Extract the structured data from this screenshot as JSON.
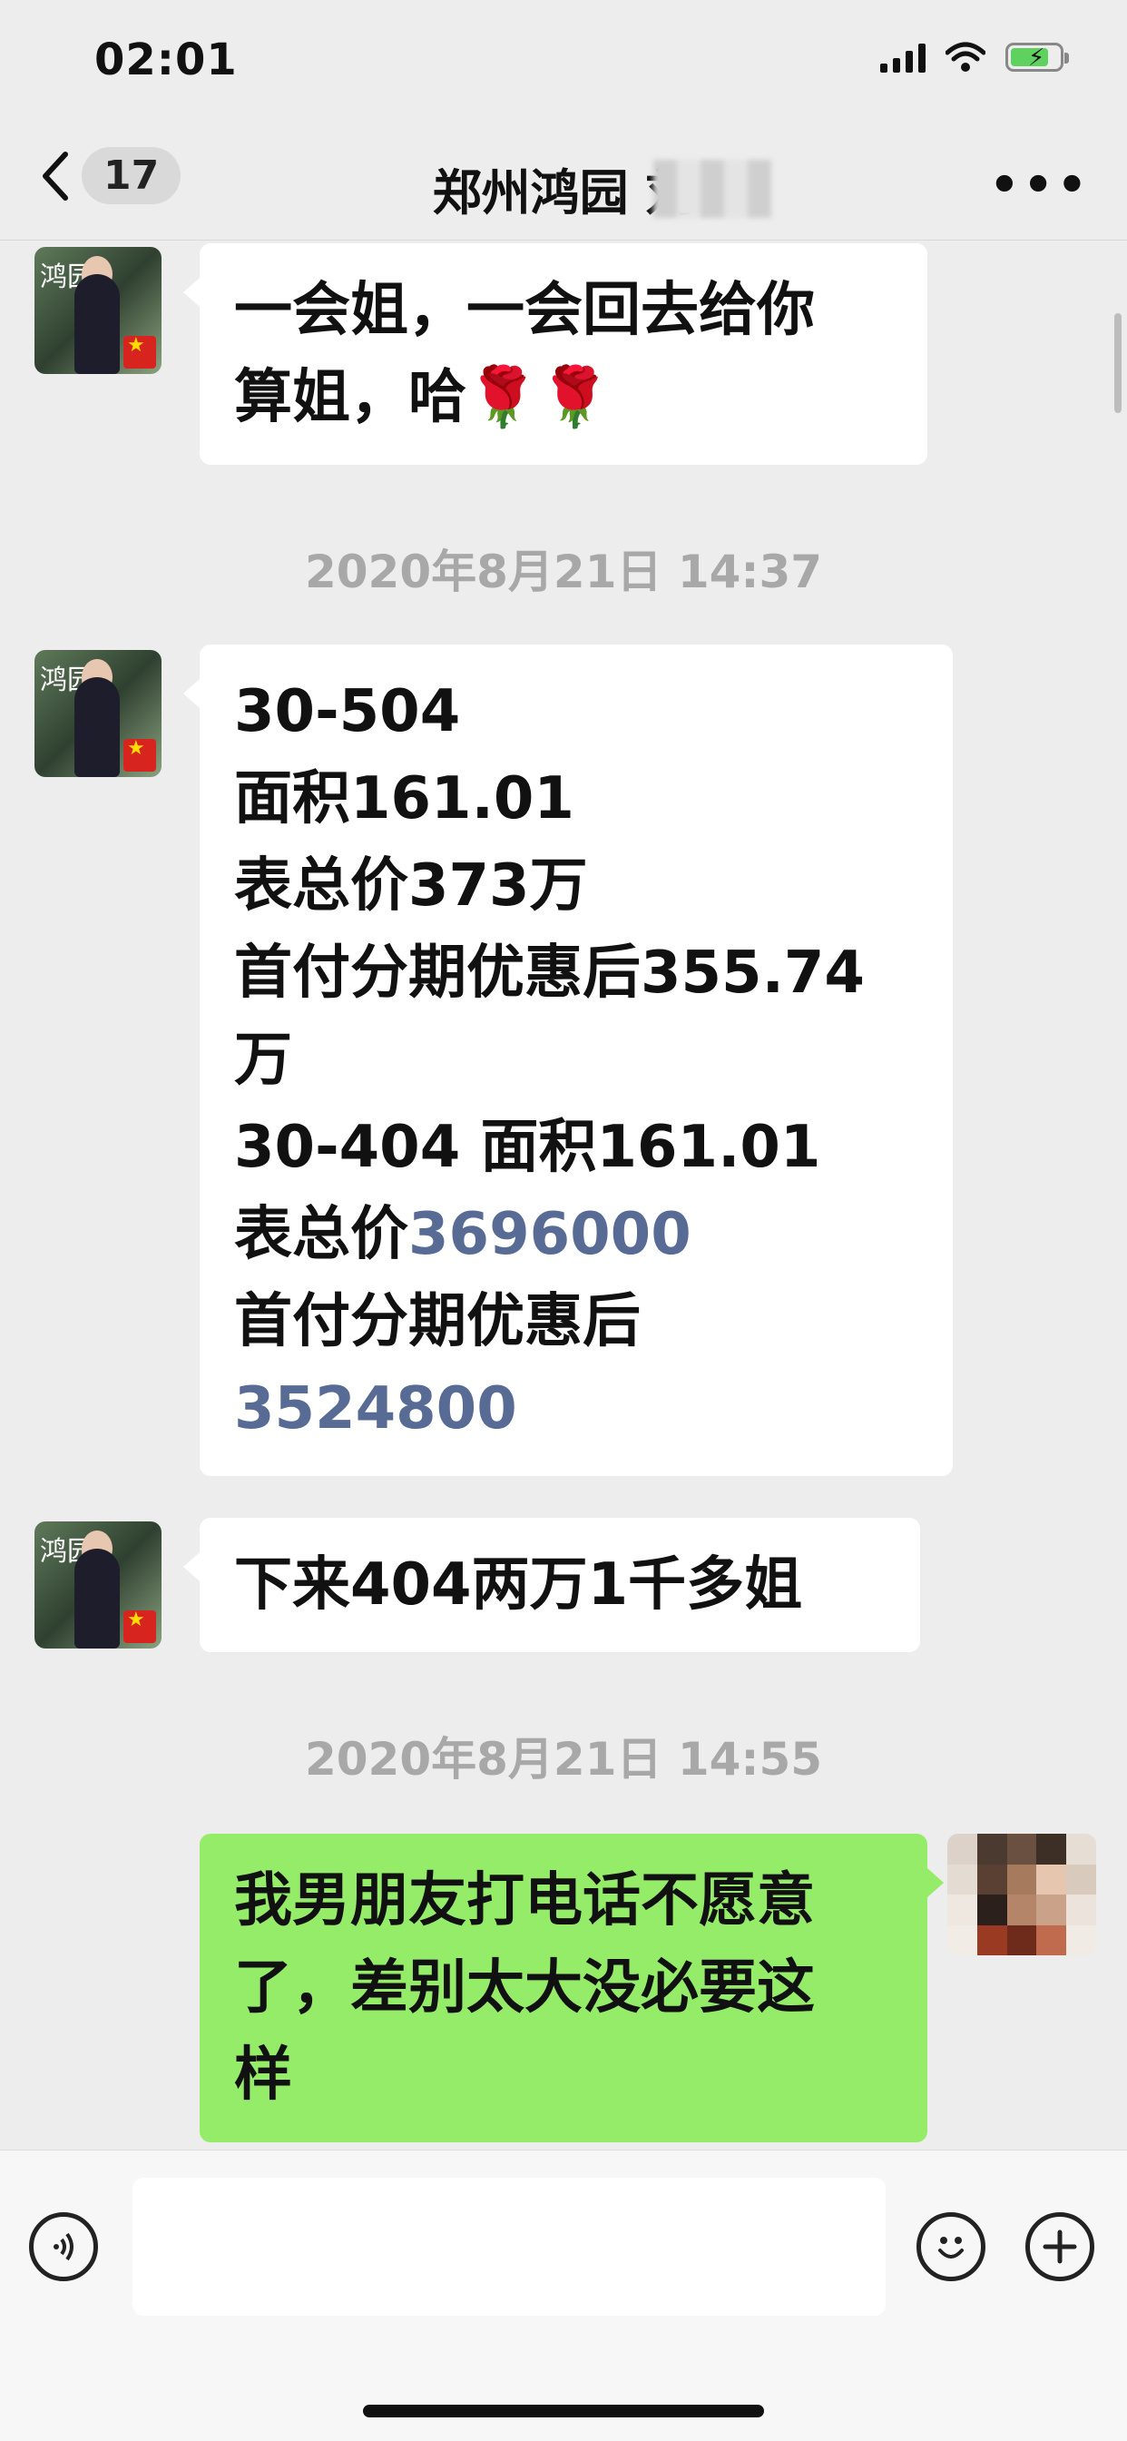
{
  "status_bar": {
    "time": "02:01"
  },
  "nav": {
    "back_count": "17",
    "title": "郑州鸿园 刘"
  },
  "messages": [
    {
      "side": "left",
      "lines": [
        "一会姐，一会回去给你",
        "算姐，哈🌹🌹"
      ]
    },
    {
      "type": "timestamp",
      "text": "2020年8月21日 14:37"
    },
    {
      "side": "left",
      "lines": [
        "30-504",
        "面积161.01",
        "表总价373万",
        "首付分期优惠后355.74",
        "万",
        "30-404 面积161.01"
      ],
      "line7_prefix": "表总价",
      "line7_number": "3696000",
      "line8": "首付分期优惠后",
      "line9_number": "3524800"
    },
    {
      "side": "left",
      "lines": [
        "下来404两万1千多姐"
      ]
    },
    {
      "type": "timestamp",
      "text": "2020年8月21日 14:55"
    },
    {
      "side": "right",
      "lines": [
        "我男朋友打电话不愿意",
        "了，差别太大没必要这",
        "样"
      ]
    }
  ],
  "avatar_logo_text": "鸿园",
  "colors": {
    "sent_bubble": "#95ec69",
    "received_bubble": "#ffffff",
    "link": "#576b95",
    "background": "#ededed"
  },
  "icons": {
    "voice": "voice-icon",
    "emoji": "emoji-icon",
    "plus": "plus-icon"
  }
}
